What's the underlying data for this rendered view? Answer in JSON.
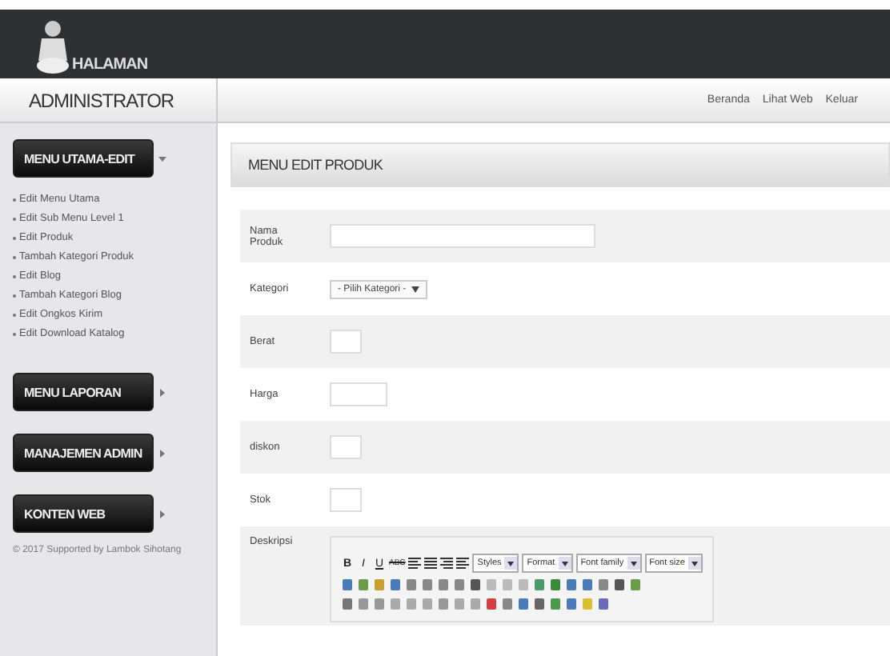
{
  "header": {
    "logo_text": "HALAMAN",
    "subtitle": "ADMINISTRATOR",
    "nav": [
      "Beranda",
      "Lihat Web",
      "Keluar"
    ]
  },
  "sidebar": {
    "sections": [
      {
        "title": "MENU UTAMA-EDIT",
        "expanded": true,
        "items": [
          "Edit Menu Utama",
          "Edit Sub Menu Level 1",
          "Edit Produk",
          "Tambah Kategori Produk",
          "Edit Blog",
          "Tambah Kategori Blog",
          "Edit Ongkos Kirim",
          "Edit Download Katalog"
        ]
      },
      {
        "title": "MENU LAPORAN",
        "expanded": false
      },
      {
        "title": "MANAJEMEN ADMIN",
        "expanded": false
      },
      {
        "title": "KONTEN WEB",
        "expanded": false
      }
    ],
    "footer": "© 2017 Supported by Lambok Sihotang"
  },
  "panel": {
    "title": "MENU EDIT PRODUK",
    "fields": [
      {
        "label": "Nama Produk",
        "kind": "text"
      },
      {
        "label": "Kategori",
        "kind": "select",
        "placeholder": "- Pilih Kategori -"
      },
      {
        "label": "Berat",
        "kind": "text"
      },
      {
        "label": "Harga",
        "kind": "text"
      },
      {
        "label": "diskon",
        "kind": "text"
      },
      {
        "label": "Stok",
        "kind": "text"
      },
      {
        "label": "Deskripsi",
        "kind": "editor",
        "format_buttons": [
          "B",
          "I",
          "U",
          "ABC"
        ],
        "dropdowns": [
          "Styles",
          "Format",
          "Font family",
          "Font size"
        ]
      }
    ]
  }
}
